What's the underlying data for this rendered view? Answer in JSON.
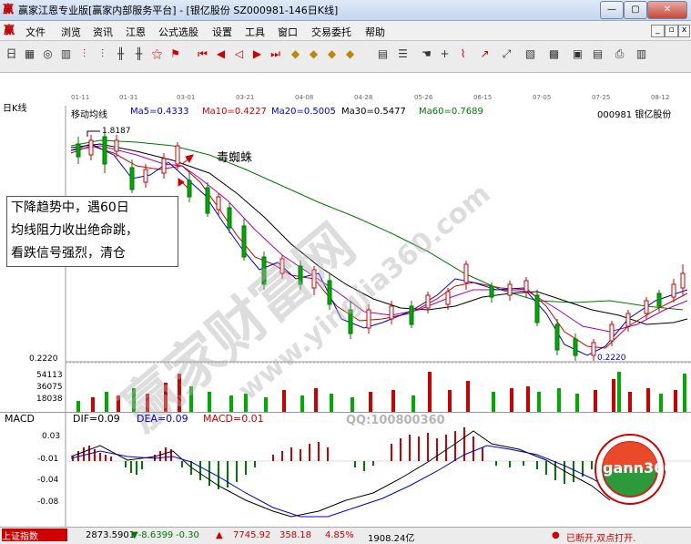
{
  "window": {
    "title": "赢家江恩专业版[赢家内部服务平台] - [银亿股份  SZ000981-146日K线]",
    "app_icon": "ying-icon"
  },
  "menu": [
    "文件",
    "浏览",
    "资讯",
    "江恩",
    "公式选股",
    "设置",
    "工具",
    "窗口",
    "交易委托",
    "帮助"
  ],
  "dates": [
    "01-11",
    "01-31",
    "03-01",
    "03-21",
    "04-08",
    "04-28",
    "05-26",
    "06-15",
    "07-05",
    "07-25",
    "08-12"
  ],
  "chart": {
    "period": "日K线",
    "indicator": "移动均线",
    "ma": [
      {
        "label": "Ma5=0.4333",
        "color": "#0000cc"
      },
      {
        "label": "Ma10=0.4227",
        "color": "#cc0000"
      },
      {
        "label": "Ma20=0.5005",
        "color": "#0000cc"
      },
      {
        "label": "Ma30=0.5477",
        "color": "#000000"
      },
      {
        "label": "Ma60=0.7689",
        "color": "#007700"
      }
    ],
    "stock": "000981  银亿股份",
    "high_label": "1.8187",
    "low_label": "0.2220",
    "y_low": "0.2220",
    "annotation": "毒蜘蛛",
    "note_lines": [
      "下降趋势中，遇60日",
      "均线阻力收出绝命跳，",
      "看跌信号强烈，清仓"
    ],
    "volume_labels": [
      "54113",
      "36075",
      "18038"
    ]
  },
  "macd": {
    "name": "MACD",
    "dif": "DIF=0.09",
    "dea": "DEA=0.09",
    "macd": "MACD=0.01",
    "ticks": [
      "0.03",
      "-0.01",
      "-0.04",
      "-0.08"
    ]
  },
  "watermarks": {
    "main": "赢家财富网",
    "url": "www.yingjia360.com",
    "qq": "QQ:100800360",
    "logo": "gann360"
  },
  "status": {
    "index": "上证指数",
    "sh_value": "2873.5901",
    "sh_change": "▼-8.6399",
    "sh_pct": "-0.30",
    "sz_value": "7745.92",
    "sz_change": "358.18",
    "sz_pct": "4.85%",
    "sz_amount": "1908.24亿",
    "conn": "已断开,双点打开."
  }
}
